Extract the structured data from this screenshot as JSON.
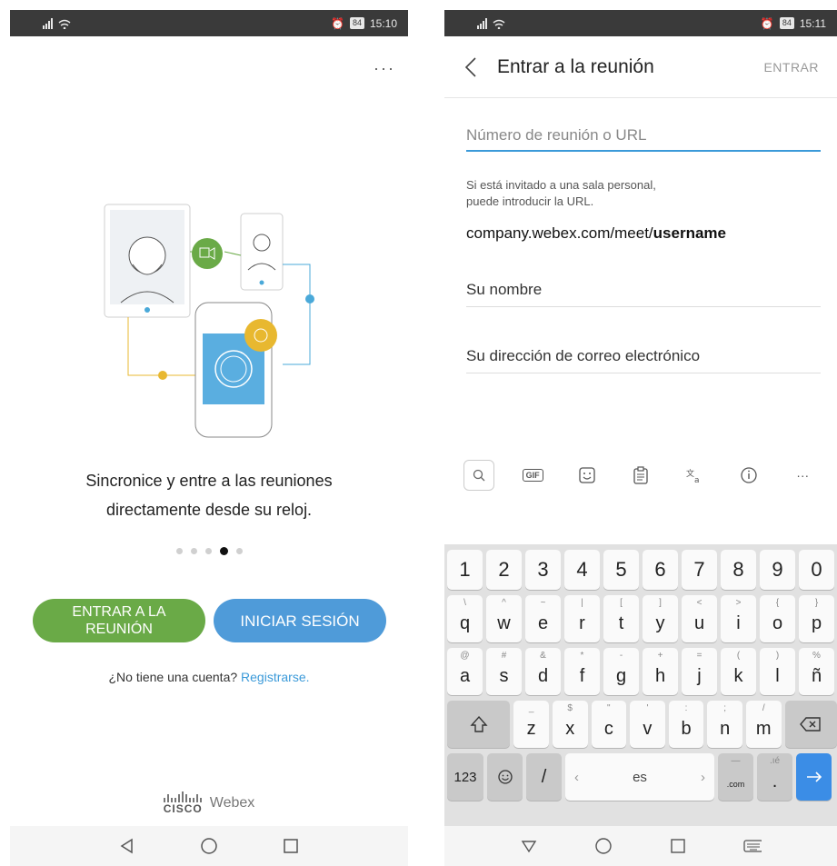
{
  "left": {
    "status": {
      "battery": "84",
      "time": "15:10"
    },
    "menu_label": "···",
    "caption_line1": "Sincronice y entre a las reuniones",
    "caption_line2": "directamente desde su reloj.",
    "join_button": "ENTRAR A LA REUNIÓN",
    "signin_button": "INICIAR SESIÓN",
    "no_account_text": "¿No tiene una cuenta?",
    "signup_link": "Registrarse.",
    "brand_cisco": "CISCO",
    "brand_webex": "Webex",
    "carousel": {
      "count": 5,
      "active_index": 3
    }
  },
  "right": {
    "status": {
      "battery": "84",
      "time": "15:11"
    },
    "title": "Entrar a la reunión",
    "action": "ENTRAR",
    "url_placeholder": "Número de reunión o URL",
    "hint_line1": "Si está invitado a una sala personal,",
    "hint_line2": "puede introducir la URL.",
    "example_prefix": "company.webex.com/meet/",
    "example_bold": "username",
    "name_placeholder": "Su nombre",
    "email_placeholder": "Su dirección de correo electrónico",
    "keyboard": {
      "toolbar": [
        "search-icon",
        "gif-icon",
        "sticker-icon",
        "clipboard-icon",
        "translate-icon",
        "info-icon",
        "more-icon"
      ],
      "gif_label": "GIF",
      "more_label": "···",
      "numbers": [
        "1",
        "2",
        "3",
        "4",
        "5",
        "6",
        "7",
        "8",
        "9",
        "0"
      ],
      "row1": [
        {
          "pri": "q",
          "sec": "\\"
        },
        {
          "pri": "w",
          "sec": "^"
        },
        {
          "pri": "e",
          "sec": "~"
        },
        {
          "pri": "r",
          "sec": "|"
        },
        {
          "pri": "t",
          "sec": "["
        },
        {
          "pri": "y",
          "sec": "]"
        },
        {
          "pri": "u",
          "sec": "<"
        },
        {
          "pri": "i",
          "sec": ">"
        },
        {
          "pri": "o",
          "sec": "{"
        },
        {
          "pri": "p",
          "sec": "}"
        }
      ],
      "row2": [
        {
          "pri": "a",
          "sec": "@"
        },
        {
          "pri": "s",
          "sec": "#"
        },
        {
          "pri": "d",
          "sec": "&"
        },
        {
          "pri": "f",
          "sec": "*"
        },
        {
          "pri": "g",
          "sec": "-"
        },
        {
          "pri": "h",
          "sec": "+"
        },
        {
          "pri": "j",
          "sec": "="
        },
        {
          "pri": "k",
          "sec": "("
        },
        {
          "pri": "l",
          "sec": ")"
        },
        {
          "pri": "ñ",
          "sec": "%"
        }
      ],
      "row3": [
        {
          "pri": "z",
          "sec": "_"
        },
        {
          "pri": "x",
          "sec": "$"
        },
        {
          "pri": "c",
          "sec": "\""
        },
        {
          "pri": "v",
          "sec": "'"
        },
        {
          "pri": "b",
          "sec": ":"
        },
        {
          "pri": "n",
          "sec": ";"
        },
        {
          "pri": "m",
          "sec": "/"
        }
      ],
      "k123": "123",
      "slash": "/",
      "space_label": "es",
      "com_label": ".com",
      "com_sec": "—",
      "dot_label": ".",
      "dot_sec": ".ıé"
    }
  }
}
